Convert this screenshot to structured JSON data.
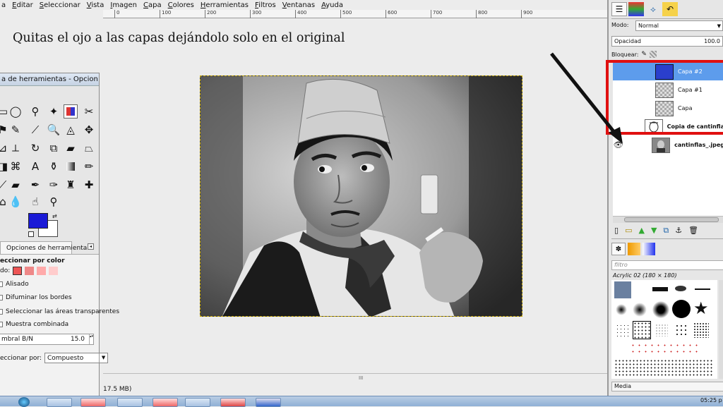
{
  "menu": [
    "a",
    "Editar",
    "Seleccionar",
    "Vista",
    "Imagen",
    "Capa",
    "Colores",
    "Herramientas",
    "Filtros",
    "Ventanas",
    "Ayuda"
  ],
  "ruler": [
    "0",
    "100",
    "200",
    "300",
    "400",
    "500",
    "600",
    "700",
    "800",
    "900"
  ],
  "instruction": "Quitas el ojo a las capas dejándolo solo en el original",
  "toolbox": {
    "title": "a de herramientas - Opcion...",
    "options_tab": "Opciones de herramienta",
    "tool_title": "eccionar por color",
    "mode_label": "do:",
    "antialias": "Alisado",
    "feather": "Difuminar los bordes",
    "select_transparent": "Seleccionar las áreas transparentes",
    "sample_merged": "Muestra combinada",
    "threshold_label": "mbral B/N",
    "threshold_value": "15.0",
    "select_by_label": "eccionar por:",
    "select_by_value": "Compuesto",
    "fg_color": "#1a1ad6",
    "bg_color": "#ffffff"
  },
  "status": {
    "text": "17.5 MB)",
    "grip": "III"
  },
  "layers_panel": {
    "mode_label": "Modo:",
    "mode_value": "Normal",
    "opacity_label": "Opacidad",
    "opacity_value": "100.0",
    "lock_label": "Bloquear:",
    "layers": [
      {
        "name": "Capa #2",
        "selected": true,
        "visible": false
      },
      {
        "name": "Capa #1",
        "selected": false,
        "visible": false
      },
      {
        "name": "Capa",
        "selected": false,
        "visible": false
      },
      {
        "name": "Copia de cantinfla",
        "selected": false,
        "visible": false
      },
      {
        "name": "cantinflas_.jpeg",
        "selected": false,
        "visible": true
      }
    ],
    "highlight_color": "#e01010",
    "selected_color": "#5d9cec"
  },
  "brushes_panel": {
    "filter_placeholder": "filtro",
    "brush_name": "Acrylic 02 (180 × 180)",
    "dock_label": "Media"
  },
  "taskbar": {
    "clock": "05:25 p"
  }
}
